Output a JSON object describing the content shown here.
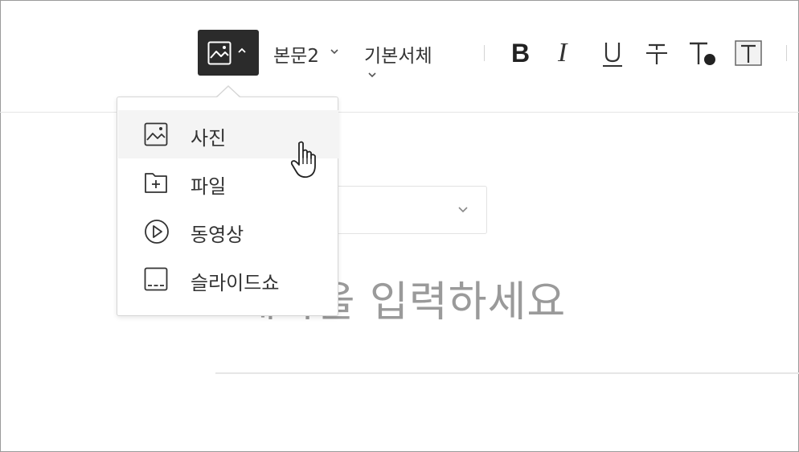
{
  "toolbar": {
    "insert_icon": "image-icon",
    "insert_chevron": "chevron-up-icon",
    "paragraph_style": "본문2",
    "font_family": "기본서체",
    "format_buttons": {
      "bold": "B",
      "italic": "I",
      "underline": "underline-icon",
      "strikethrough": "strikethrough-icon",
      "text_color": "text-color-icon",
      "text_background": "text-background-icon"
    }
  },
  "insert_menu": {
    "items": [
      {
        "label": "사진",
        "icon": "image-icon",
        "active": true
      },
      {
        "label": "파일",
        "icon": "folder-plus-icon",
        "active": false
      },
      {
        "label": "동영상",
        "icon": "play-circle-icon",
        "active": false
      },
      {
        "label": "슬라이드쇼",
        "icon": "slideshow-icon",
        "active": false
      }
    ]
  },
  "editor": {
    "title_placeholder": "제목을 입력하세요"
  },
  "colors": {
    "insert_button_bg": "#2b2b2b",
    "menu_hover_bg": "#f4f4f4",
    "placeholder_text": "#9a9a9a"
  }
}
